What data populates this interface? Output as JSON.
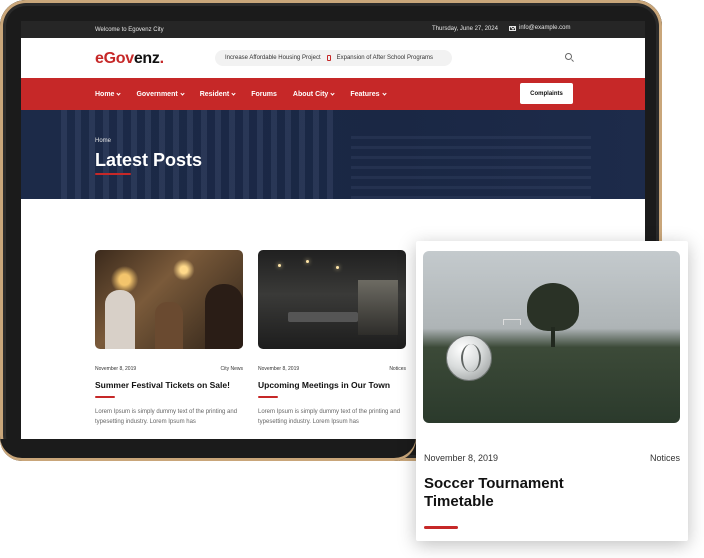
{
  "topbar": {
    "welcome": "Welcome to Egovenz City",
    "date": "Thursday, June 27, 2024",
    "email": "info@example.com"
  },
  "header": {
    "logo_first": "eGov",
    "logo_rest": "enz",
    "logo_dot": ".",
    "ticker_1": "Increase Affordable Housing Project",
    "ticker_2": "Expansion of After School Programs"
  },
  "nav": {
    "items": [
      "Home",
      "Government",
      "Resident",
      "Forums",
      "About City",
      "Features"
    ],
    "button": "Complaints"
  },
  "hero": {
    "breadcrumb": "Home",
    "title": "Latest Posts"
  },
  "posts": [
    {
      "date": "November 8, 2019",
      "category": "City News",
      "title": "Summer Festival Tickets on Sale!",
      "excerpt": "Lorem Ipsum is simply dummy text of the printing and typesetting industry. Lorem Ipsum has"
    },
    {
      "date": "November 8, 2019",
      "category": "Notices",
      "title": "Upcoming Meetings in Our Town",
      "excerpt": "Lorem Ipsum is simply dummy text of the printing and typesetting industry. Lorem Ipsum has"
    }
  ],
  "featured": {
    "date": "November 8, 2019",
    "category": "Notices",
    "title": "Soccer Tournament Timetable"
  },
  "colors": {
    "accent": "#c62828",
    "hero_bg": "#1c2a48",
    "topbar_bg": "#262626"
  }
}
